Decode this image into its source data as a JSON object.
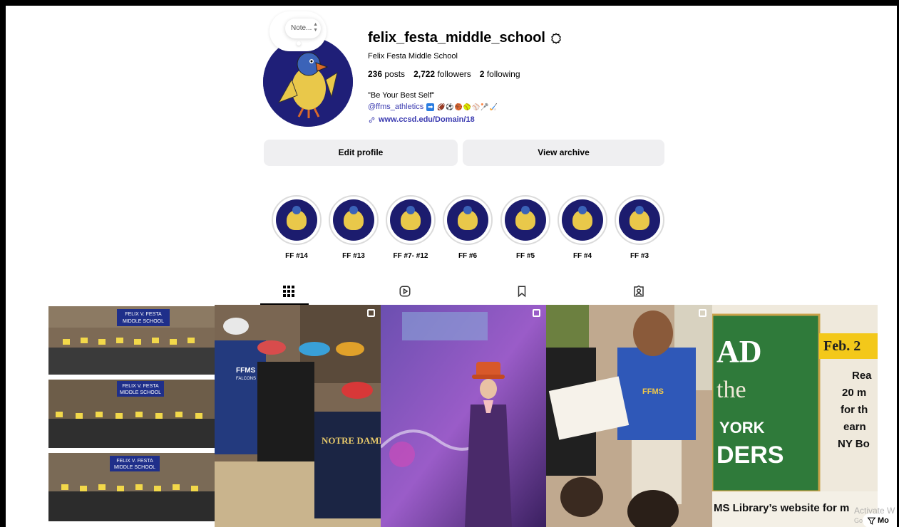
{
  "profile": {
    "note": "Note...",
    "username": "felix_festa_middle_school",
    "full_name": "Felix Festa Middle School",
    "posts_count": "236",
    "posts_label": "posts",
    "followers_count": "2,722",
    "followers_label": "followers",
    "following_count": "2",
    "following_label": "following",
    "bio_line1": "\"Be Your Best Self\"",
    "bio_mention": "@ffms_athletics",
    "bio_emojis": "🏈⚽🏀🥎⚾🥍🏑",
    "link": "www.ccsd.edu/Domain/18"
  },
  "actions": {
    "edit_profile": "Edit profile",
    "view_archive": "View archive"
  },
  "highlights": [
    {
      "label": "FF #14"
    },
    {
      "label": "FF #13"
    },
    {
      "label": "FF #7- #12"
    },
    {
      "label": "FF #6"
    },
    {
      "label": "FF #5"
    },
    {
      "label": "FF #4"
    },
    {
      "label": "FF #3"
    }
  ],
  "tabs": [
    {
      "name": "posts",
      "icon": "grid-icon",
      "active": true
    },
    {
      "name": "reels",
      "icon": "reels-icon",
      "active": false
    },
    {
      "name": "saved",
      "icon": "bookmark-icon",
      "active": false
    },
    {
      "name": "tagged",
      "icon": "tagged-icon",
      "active": false
    }
  ],
  "posts": {
    "t1_sign_top": "FELIX V. FESTA",
    "t1_sign_bottom": "MIDDLE SCHOOL",
    "t2_hoodie": "FFMS",
    "t2_hoodie_sub": "FALCONS",
    "t2_shirt": "NOTRE DAME",
    "t4_shirt": "FFMS",
    "t5_date": "Feb. 2",
    "t5_board_1": "AD",
    "t5_board_2": "the",
    "t5_board_3": "YORK",
    "t5_board_4": "DERS",
    "t5_side_1": "Rea",
    "t5_side_2": "20 m",
    "t5_side_3": "for th",
    "t5_side_4": "earn",
    "t5_side_5": "NY Bo",
    "t5_footer": "MS Library’s website for m"
  },
  "system": {
    "watermark_1": "Activate W",
    "watermark_2": "Go to Settings",
    "filter_label": "Mo"
  },
  "colors": {
    "link": "#3a3ab0",
    "avatar_bg": "#1f1f78",
    "button_bg": "#efeff1"
  }
}
